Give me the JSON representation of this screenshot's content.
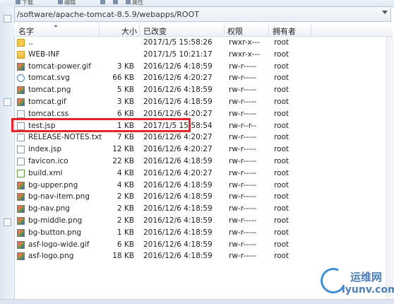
{
  "toolbar": {
    "items": [
      {
        "label": "下载",
        "icon": "download-icon"
      },
      {
        "label": "编辑",
        "icon": "edit-icon"
      },
      {
        "label": "",
        "icon": "cut-icon"
      },
      {
        "label": "",
        "icon": "copy-icon"
      },
      {
        "label": "属性",
        "icon": "properties-icon"
      }
    ]
  },
  "path": "/software/apache-tomcat-8.5.9/webapps/ROOT",
  "columns": {
    "name": "名字",
    "size": "大小",
    "modified": "已改变",
    "permissions": "权限",
    "owner": "拥有者"
  },
  "files": [
    {
      "name": "..",
      "size": "",
      "modified": "2017/1/5 15:58:26",
      "permissions": "rwxr-x---",
      "owner": "root",
      "icon": "parent-folder-icon"
    },
    {
      "name": "WEB-INF",
      "size": "",
      "modified": "2017/1/5 10:21:17",
      "permissions": "rwxr-x---",
      "owner": "root",
      "icon": "folder-icon"
    },
    {
      "name": "tomcat-power.gif",
      "size": "3 KB",
      "modified": "2016/12/6 4:18:59",
      "permissions": "rw-r-----",
      "owner": "root",
      "icon": "image-icon"
    },
    {
      "name": "tomcat.svg",
      "size": "66 KB",
      "modified": "2016/12/6 4:20:27",
      "permissions": "rw-r-----",
      "owner": "root",
      "icon": "svg-icon"
    },
    {
      "name": "tomcat.png",
      "size": "5 KB",
      "modified": "2016/12/6 4:18:59",
      "permissions": "rw-r-----",
      "owner": "root",
      "icon": "image-icon"
    },
    {
      "name": "tomcat.gif",
      "size": "3 KB",
      "modified": "2016/12/6 4:18:59",
      "permissions": "rw-r-----",
      "owner": "root",
      "icon": "image-icon"
    },
    {
      "name": "tomcat.css",
      "size": "6 KB",
      "modified": "2016/12/6 4:20:27",
      "permissions": "rw-r-----",
      "owner": "root",
      "icon": "file-icon"
    },
    {
      "name": "test.jsp",
      "size": "1 KB",
      "modified": "2017/1/5 15:58:54",
      "permissions": "rw-r--r--",
      "owner": "root",
      "icon": "file-icon"
    },
    {
      "name": "RELEASE-NOTES.txt",
      "size": "7 KB",
      "modified": "2016/12/6 4:20:27",
      "permissions": "rw-r-----",
      "owner": "root",
      "icon": "file-icon"
    },
    {
      "name": "index.jsp",
      "size": "12 KB",
      "modified": "2016/12/6 4:20:27",
      "permissions": "rw-r-----",
      "owner": "root",
      "icon": "file-icon"
    },
    {
      "name": "favicon.ico",
      "size": "22 KB",
      "modified": "2016/12/6 4:18:59",
      "permissions": "rw-r-----",
      "owner": "root",
      "icon": "file-icon"
    },
    {
      "name": "build.xml",
      "size": "4 KB",
      "modified": "2016/12/6 4:20:27",
      "permissions": "rw-r-----",
      "owner": "root",
      "icon": "xml-icon"
    },
    {
      "name": "bg-upper.png",
      "size": "4 KB",
      "modified": "2016/12/6 4:18:59",
      "permissions": "rw-r-----",
      "owner": "root",
      "icon": "image-icon"
    },
    {
      "name": "bg-nav-item.png",
      "size": "2 KB",
      "modified": "2016/12/6 4:18:59",
      "permissions": "rw-r-----",
      "owner": "root",
      "icon": "image-icon"
    },
    {
      "name": "bg-nav.png",
      "size": "2 KB",
      "modified": "2016/12/6 4:18:59",
      "permissions": "rw-r-----",
      "owner": "root",
      "icon": "image-icon"
    },
    {
      "name": "bg-middle.png",
      "size": "2 KB",
      "modified": "2016/12/6 4:18:59",
      "permissions": "rw-r-----",
      "owner": "root",
      "icon": "image-icon"
    },
    {
      "name": "bg-button.png",
      "size": "1 KB",
      "modified": "2016/12/6 4:18:59",
      "permissions": "rw-r-----",
      "owner": "root",
      "icon": "image-icon"
    },
    {
      "name": "asf-logo-wide.gif",
      "size": "6 KB",
      "modified": "2016/12/6 4:18:59",
      "permissions": "rw-r-----",
      "owner": "root",
      "icon": "image-icon"
    },
    {
      "name": "asf-logo.png",
      "size": "18 KB",
      "modified": "2016/12/6 4:18:59",
      "permissions": "rw-r-----",
      "owner": "root",
      "icon": "image-icon"
    }
  ],
  "watermark": {
    "cn": "运维网",
    "en": "iyunv.com"
  },
  "colors": {
    "highlight": "#e8242b",
    "accent": "#3d73b5"
  }
}
